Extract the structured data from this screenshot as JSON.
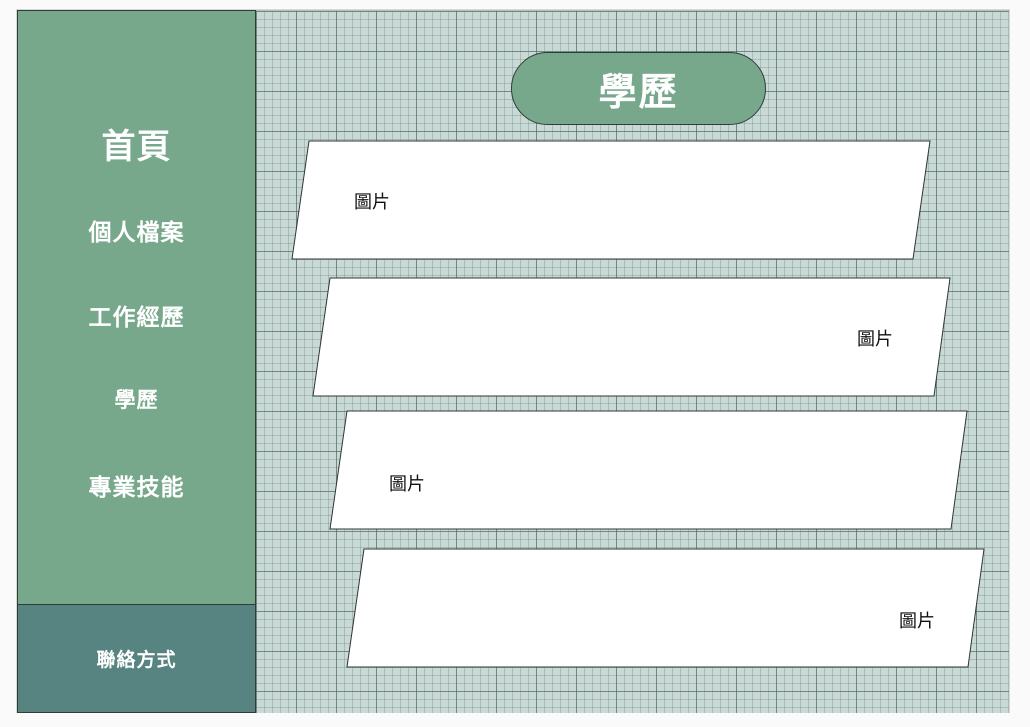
{
  "sidebar": {
    "items": [
      {
        "label": "首頁"
      },
      {
        "label": "個人檔案"
      },
      {
        "label": "工作經歷"
      },
      {
        "label": "學歷"
      },
      {
        "label": "專業技能"
      }
    ],
    "contact_label": "聯絡方式"
  },
  "main": {
    "title": "學歷",
    "cards": [
      {
        "image_label": "圖片"
      },
      {
        "image_label": "圖片"
      },
      {
        "image_label": "圖片"
      },
      {
        "image_label": "圖片"
      }
    ]
  },
  "colors": {
    "sidebar": "#77a88c",
    "contact": "#578480",
    "grid_background": "#c9dad6",
    "card": "#ffffff"
  }
}
